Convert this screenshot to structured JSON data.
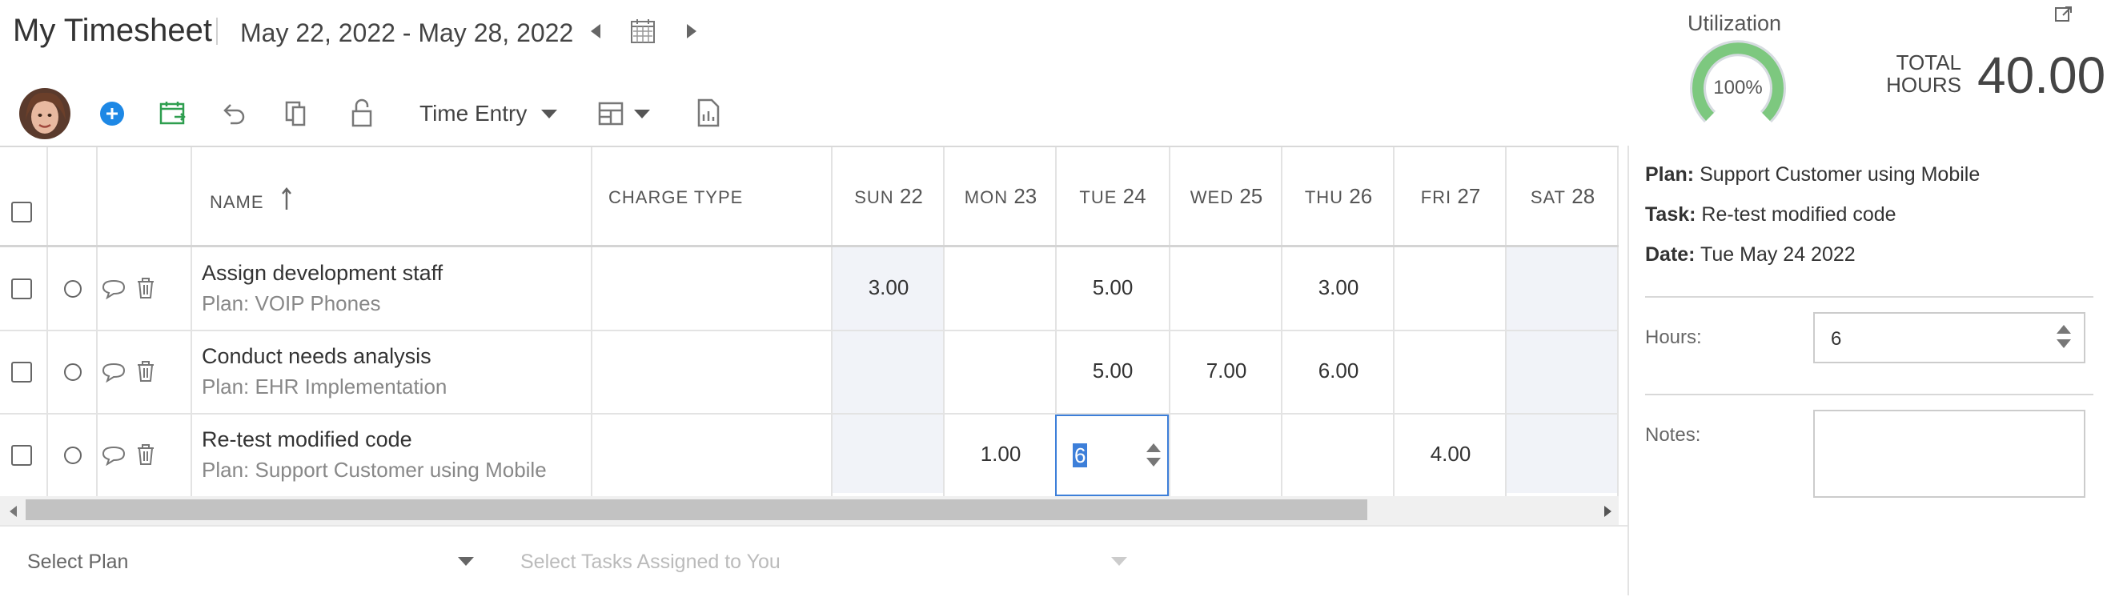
{
  "header": {
    "title": "My Timesheet",
    "date_range": "May 22, 2022 - May 28, 2022"
  },
  "toolbar": {
    "view_select": "Time Entry"
  },
  "utilization": {
    "label": "Utilization",
    "percent_text": "100%",
    "percent": 100,
    "total_label_line1": "TOTAL",
    "total_label_line2": "HOURS",
    "total_value": "40.00"
  },
  "grid": {
    "headers": {
      "name": "NAME",
      "charge_type": "CHARGE TYPE",
      "days": [
        {
          "dow": "SUN",
          "day": "22"
        },
        {
          "dow": "MON",
          "day": "23"
        },
        {
          "dow": "TUE",
          "day": "24"
        },
        {
          "dow": "WED",
          "day": "25"
        },
        {
          "dow": "THU",
          "day": "26"
        },
        {
          "dow": "FRI",
          "day": "27"
        },
        {
          "dow": "SAT",
          "day": "28"
        }
      ]
    },
    "rows": [
      {
        "name": "Assign development staff",
        "plan": "Plan: VOIP Phones",
        "hours": [
          "3.00",
          "",
          "5.00",
          "",
          "3.00",
          "",
          ""
        ]
      },
      {
        "name": "Conduct needs analysis",
        "plan": "Plan: EHR Implementation",
        "hours": [
          "",
          "",
          "5.00",
          "7.00",
          "6.00",
          "",
          ""
        ]
      },
      {
        "name": "Re-test modified code",
        "plan": "Plan: Support Customer using Mobile",
        "hours": [
          "",
          "1.00",
          "6",
          "",
          "",
          "4.00",
          ""
        ]
      }
    ]
  },
  "detail_panel": {
    "plan_label": "Plan:",
    "plan_value": "Support Customer using Mobile",
    "task_label": "Task:",
    "task_value": "Re-test modified code",
    "date_label": "Date:",
    "date_value": "Tue May 24 2022",
    "hours_label": "Hours:",
    "hours_value": "6",
    "notes_label": "Notes:",
    "notes_value": ""
  },
  "bottom": {
    "plan_placeholder": "Select Plan",
    "task_placeholder": "Select Tasks Assigned to You"
  },
  "colors": {
    "accent_blue": "#1e88e5",
    "green": "#2e9e4f",
    "gauge_green": "#7dc87f",
    "weekend_bg": "#f1f3f8",
    "selection": "#3d7fd9"
  }
}
